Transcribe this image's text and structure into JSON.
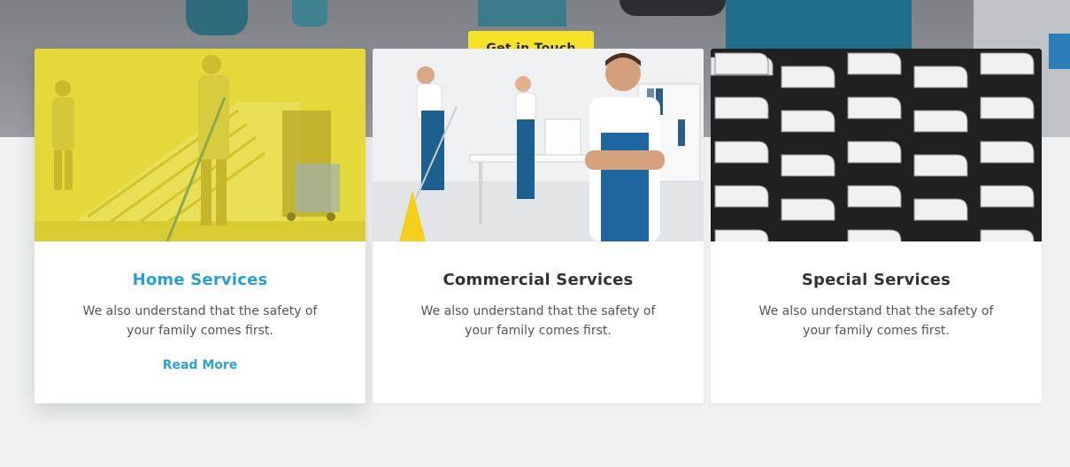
{
  "hero": {
    "cta_label": "Get in Touch"
  },
  "colors": {
    "accent": "#2a9fd6",
    "cta_yellow": "#f7e22a",
    "page_background": "#eef1f0"
  },
  "cards": [
    {
      "title": "Home Services",
      "description": "We also understand that the safety of your family comes first.",
      "link": "Read More",
      "image": "yellow-tinted-cleaner-mopping-stairs-photo"
    },
    {
      "title": "Commercial Services",
      "description": "We also understand that the safety of your family comes first.",
      "image": "office-cleaning-team-photo"
    },
    {
      "title": "Special Services",
      "description": "We also understand that the safety of your family comes first.",
      "image": "grayscale-apartment-balconies-photo"
    }
  ]
}
